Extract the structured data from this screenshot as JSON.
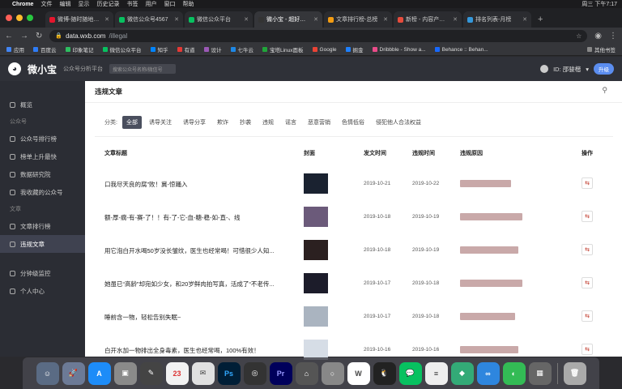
{
  "menubar": {
    "app": "Chrome",
    "items": [
      "文件",
      "编辑",
      "显示",
      "历史记录",
      "书签",
      "用户",
      "窗口",
      "帮助"
    ],
    "clock": "周三 下午7:17"
  },
  "tabs": [
    {
      "label": "微博-随时随地发现",
      "active": false
    },
    {
      "label": "微信公众号4567",
      "active": false
    },
    {
      "label": "微信公众平台",
      "active": false
    },
    {
      "label": "微小宝 - 超好用的微",
      "active": true
    },
    {
      "label": "文章排行榜-总榜",
      "active": false
    },
    {
      "label": "新榜 - 内容产业服务",
      "active": false
    },
    {
      "label": "排名列表-月榜",
      "active": false
    }
  ],
  "address": {
    "domain": "data.wxb.com",
    "path": "/illegal"
  },
  "bookmarks": [
    "应用",
    "百度云",
    "印象笔记",
    "微信公众平台",
    "知乎",
    "有道",
    "设计",
    "七牛云",
    "宝塔Linux面板",
    "Google",
    "掘金",
    "Dribbble - Show a...",
    "Behance :: Behan..."
  ],
  "bookmarks_other": "其他书签",
  "header": {
    "logo": "微小宝",
    "subtitle": "公众号分析平台",
    "search_placeholder": "搜索公众号名称/微信号",
    "user": "ID: 邵骏楷",
    "upgrade": "升级"
  },
  "sidebar": {
    "overview": "概览",
    "section_account": "公众号",
    "items_account": [
      "公众号排行榜",
      "榜单上升最快",
      "数据研究院",
      "我收藏的公众号"
    ],
    "section_article": "文章",
    "items_article": [
      "文章排行榜",
      "违规文章"
    ],
    "items_bottom": [
      "分钟级监控",
      "个人中心"
    ]
  },
  "card": {
    "title": "违规文章",
    "filter_label": "分类:",
    "filters": [
      "全部",
      "诱导关注",
      "诱导分享",
      "欺诈",
      "抄袭",
      "违规",
      "谣言",
      "恶意营销",
      "色情低俗",
      "侵犯他人合法权益"
    ],
    "columns": {
      "title": "文章标题",
      "cover": "封面",
      "pub": "发文时间",
      "viol": "违规时间",
      "reason": "违规原因",
      "op": "操作"
    }
  },
  "rows": [
    {
      "title": "口我尽天良的腐”败！冀-惊踊入",
      "pub": "2019-10-21",
      "viol": "2019-10-22",
      "reason_width": 0.7
    },
    {
      "title": "额-厚-瘸-有-赛-了！！有-了-它-血-糖-稳-如-直-、线",
      "pub": "2019-10-18",
      "viol": "2019-10-19",
      "reason_width": 0.85
    },
    {
      "title": "用它泡白开水喝50岁没长皱纹，医生也经常喝！可惜很少人知...",
      "pub": "2019-10-18",
      "viol": "2019-10-19",
      "reason_width": 0.8
    },
    {
      "title": "她虽已“高龄”却宛如少女，和20岁鲜肉拍写真，活成了“不老传...",
      "pub": "2019-10-17",
      "viol": "2019-10-18",
      "reason_width": 0.85
    },
    {
      "title": "睡前含一物，轻松告别失眠~",
      "pub": "2019-10-17",
      "viol": "2019-10-18",
      "reason_width": 0.75
    },
    {
      "title": "白开水加一物排出全身毒素，医生也经常喝，100%有效！",
      "pub": "2019-10-16",
      "viol": "2019-10-16",
      "reason_width": 0.8
    }
  ],
  "op_icon": "share-icon"
}
